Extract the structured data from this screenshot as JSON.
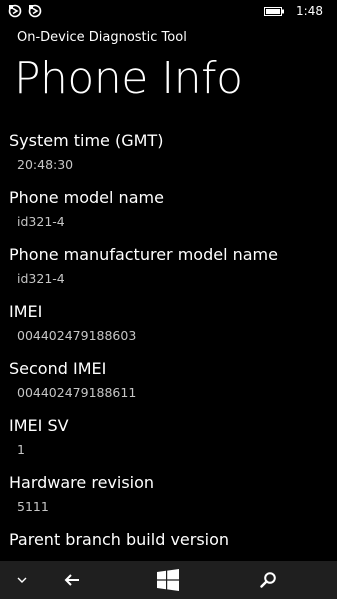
{
  "status_bar": {
    "time": "1:48",
    "left_icons": [
      "notification-icon",
      "notification-icon"
    ],
    "battery_icon": "battery-icon"
  },
  "header": {
    "app_title": "On-Device Diagnostic Tool",
    "page_title": "Phone Info"
  },
  "items": [
    {
      "label": "System time (GMT)",
      "value": "20:48:30"
    },
    {
      "label": "Phone model name",
      "value": "id321-4"
    },
    {
      "label": "Phone manufacturer model name",
      "value": "id321-4"
    },
    {
      "label": "IMEI",
      "value": "004402479188603"
    },
    {
      "label": "Second IMEI",
      "value": "004402479188611"
    },
    {
      "label": "IMEI SV",
      "value": "1"
    },
    {
      "label": "Hardware revision",
      "value": "5111"
    },
    {
      "label": "Parent branch build version",
      "value": ""
    }
  ],
  "nav_bar": {
    "buttons": [
      "chevron-down-icon",
      "back-arrow-icon",
      "windows-start-icon",
      "search-icon"
    ]
  }
}
